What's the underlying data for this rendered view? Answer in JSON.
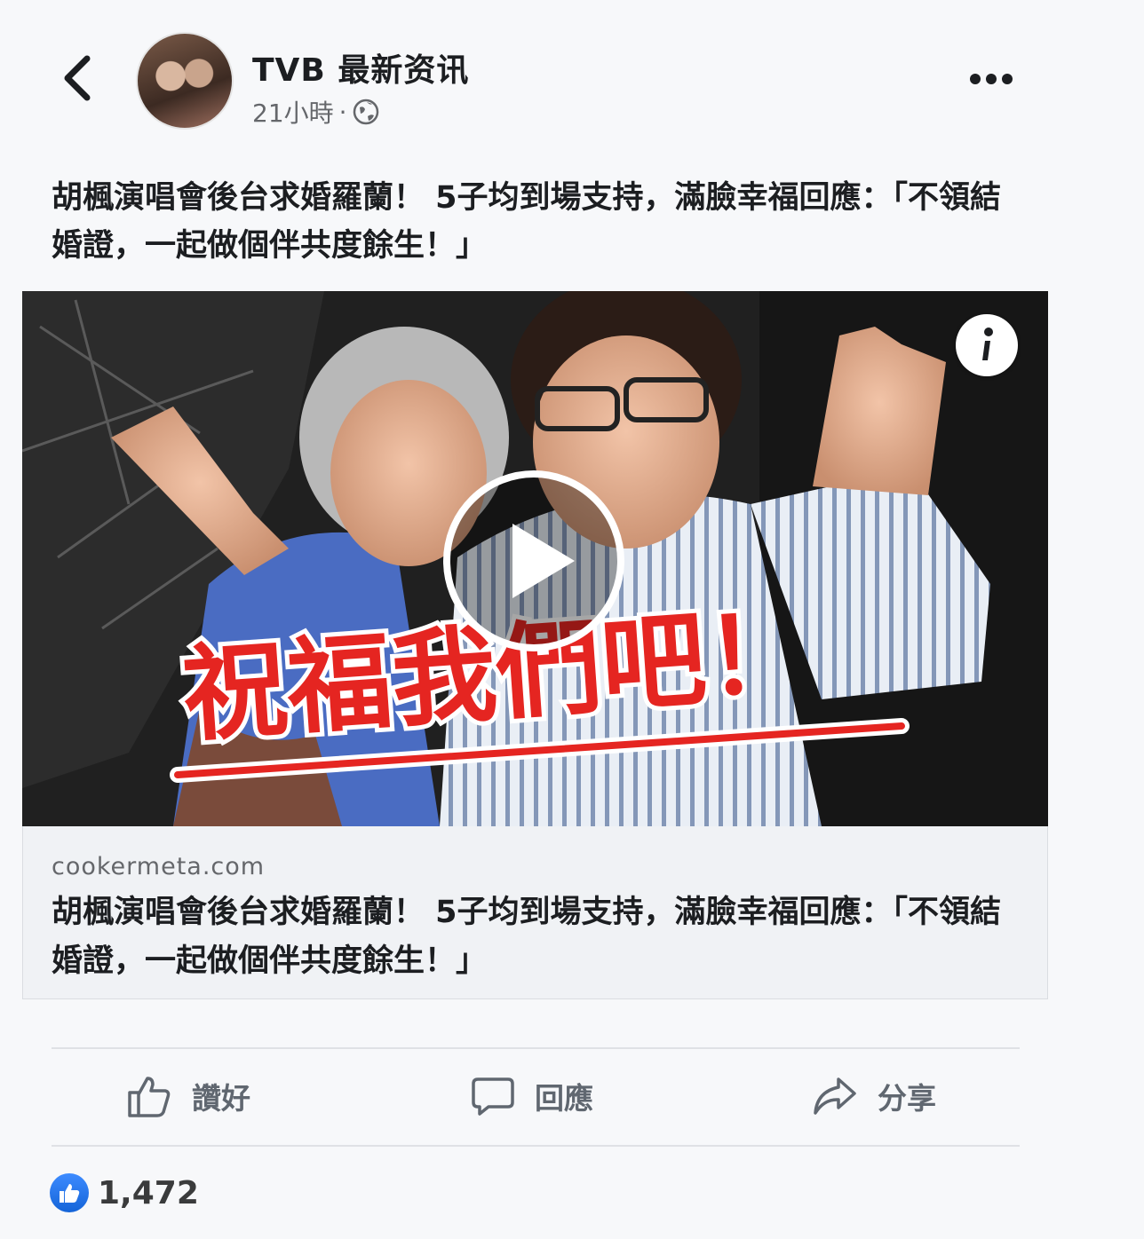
{
  "header": {
    "page_name": "TVB 最新资讯",
    "timestamp": "21小時",
    "separator": "·"
  },
  "post": {
    "caption": "胡楓演唱會後台求婚羅蘭！ 5子均到場支持，滿臉幸福回應：「不領結婚證，一起做個伴共度餘生！」",
    "thumbnail_overlay_text": "祝福我們吧！"
  },
  "link_preview": {
    "domain": "cookermeta.com",
    "title": "胡楓演唱會後台求婚羅蘭！ 5子均到場支持，滿臉幸福回應：「不領結婚證，一起做個伴共度餘生！」"
  },
  "actions": {
    "like_label": "讚好",
    "comment_label": "回應",
    "share_label": "分享"
  },
  "reactions": {
    "count": "1,472",
    "icon": "like-icon"
  },
  "colors": {
    "accent_red": "#e52521",
    "like_blue": "#1877f2"
  }
}
